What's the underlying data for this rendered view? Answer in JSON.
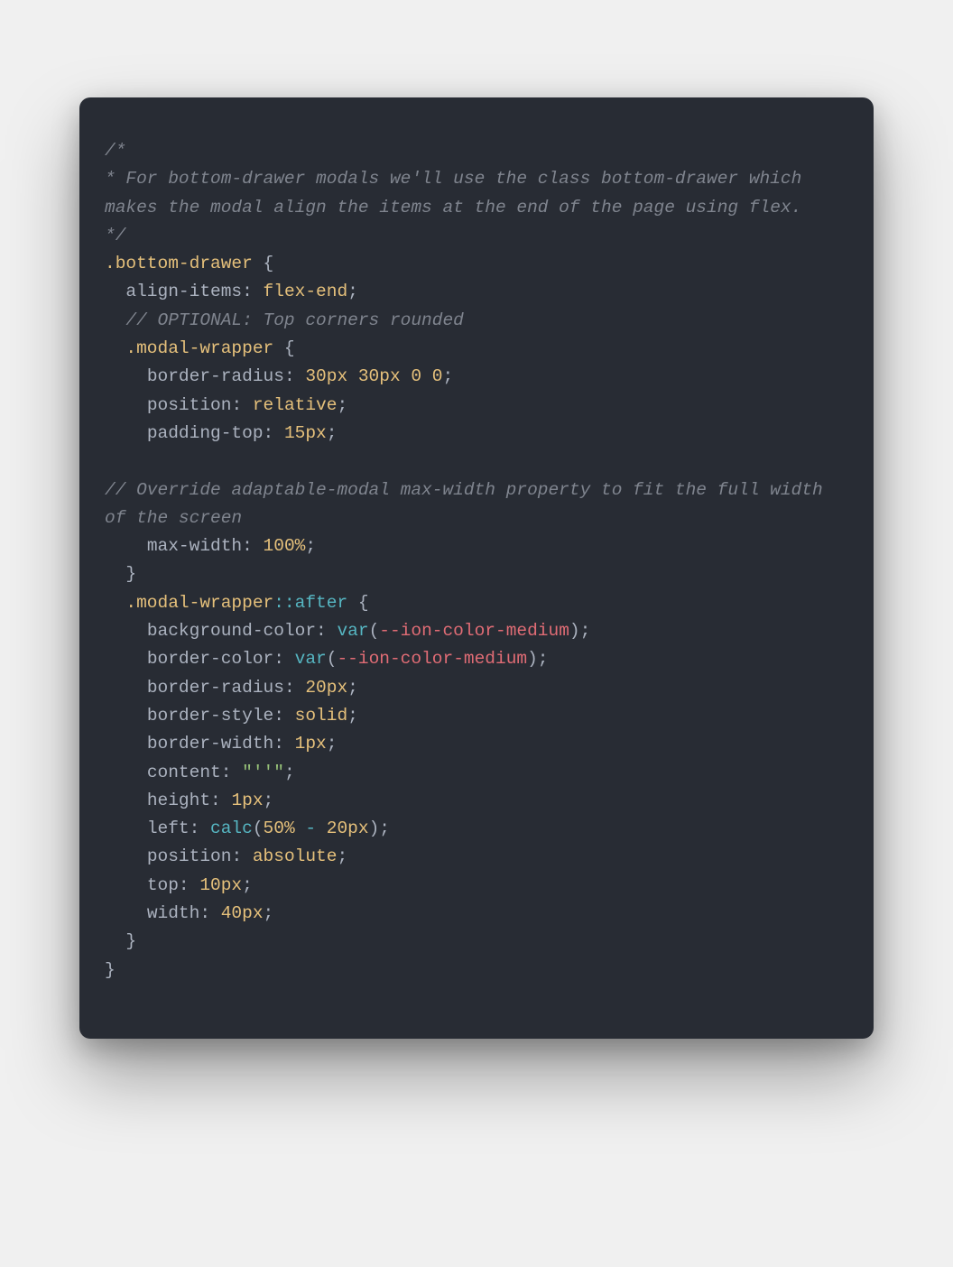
{
  "code": {
    "language": "scss",
    "tokens": [
      {
        "c": "tok-comment",
        "t": "/*"
      },
      {
        "nl": 1
      },
      {
        "c": "tok-comment",
        "t": "* For bottom-drawer modals we'll use the class bottom-drawer which makes the modal align the items at the end of the page using flex."
      },
      {
        "nl": 1
      },
      {
        "c": "tok-comment",
        "t": "*/"
      },
      {
        "nl": 1
      },
      {
        "c": "tok-selector",
        "t": ".bottom-drawer"
      },
      {
        "c": "tok-punct",
        "t": " {"
      },
      {
        "nl": 1
      },
      {
        "t": "  "
      },
      {
        "c": "tok-prop",
        "t": "align-items"
      },
      {
        "c": "tok-punct",
        "t": ": "
      },
      {
        "c": "tok-value",
        "t": "flex-end"
      },
      {
        "c": "tok-punct",
        "t": ";"
      },
      {
        "nl": 1
      },
      {
        "t": "  "
      },
      {
        "c": "tok-comment",
        "t": "// OPTIONAL: Top corners rounded"
      },
      {
        "nl": 1
      },
      {
        "t": "  "
      },
      {
        "c": "tok-selector",
        "t": ".modal-wrapper"
      },
      {
        "c": "tok-punct",
        "t": " {"
      },
      {
        "nl": 1
      },
      {
        "t": "    "
      },
      {
        "c": "tok-prop",
        "t": "border-radius"
      },
      {
        "c": "tok-punct",
        "t": ": "
      },
      {
        "c": "tok-number",
        "t": "30px 30px 0 0"
      },
      {
        "c": "tok-punct",
        "t": ";"
      },
      {
        "nl": 1
      },
      {
        "t": "    "
      },
      {
        "c": "tok-prop",
        "t": "position"
      },
      {
        "c": "tok-punct",
        "t": ": "
      },
      {
        "c": "tok-value",
        "t": "relative"
      },
      {
        "c": "tok-punct",
        "t": ";"
      },
      {
        "nl": 1
      },
      {
        "t": "    "
      },
      {
        "c": "tok-prop",
        "t": "padding-top"
      },
      {
        "c": "tok-punct",
        "t": ": "
      },
      {
        "c": "tok-number",
        "t": "15px"
      },
      {
        "c": "tok-punct",
        "t": ";"
      },
      {
        "nl": 1
      },
      {
        "nl": 1
      },
      {
        "c": "tok-comment",
        "t": "// Override adaptable-modal max-width property to fit the full width of the screen"
      },
      {
        "nl": 1
      },
      {
        "t": "    "
      },
      {
        "c": "tok-prop",
        "t": "max-width"
      },
      {
        "c": "tok-punct",
        "t": ": "
      },
      {
        "c": "tok-number",
        "t": "100%"
      },
      {
        "c": "tok-punct",
        "t": ";"
      },
      {
        "nl": 1
      },
      {
        "t": "  "
      },
      {
        "c": "tok-punct",
        "t": "}"
      },
      {
        "nl": 1
      },
      {
        "t": "  "
      },
      {
        "c": "tok-selector",
        "t": ".modal-wrapper"
      },
      {
        "c": "tok-pseudo",
        "t": "::after"
      },
      {
        "c": "tok-punct",
        "t": " {"
      },
      {
        "nl": 1
      },
      {
        "t": "    "
      },
      {
        "c": "tok-prop",
        "t": "background-color"
      },
      {
        "c": "tok-punct",
        "t": ": "
      },
      {
        "c": "tok-func",
        "t": "var"
      },
      {
        "c": "tok-punct",
        "t": "("
      },
      {
        "c": "tok-varname",
        "t": "--ion-color-medium"
      },
      {
        "c": "tok-punct",
        "t": ");"
      },
      {
        "nl": 1
      },
      {
        "t": "    "
      },
      {
        "c": "tok-prop",
        "t": "border-color"
      },
      {
        "c": "tok-punct",
        "t": ": "
      },
      {
        "c": "tok-func",
        "t": "var"
      },
      {
        "c": "tok-punct",
        "t": "("
      },
      {
        "c": "tok-varname",
        "t": "--ion-color-medium"
      },
      {
        "c": "tok-punct",
        "t": ");"
      },
      {
        "nl": 1
      },
      {
        "t": "    "
      },
      {
        "c": "tok-prop",
        "t": "border-radius"
      },
      {
        "c": "tok-punct",
        "t": ": "
      },
      {
        "c": "tok-number",
        "t": "20px"
      },
      {
        "c": "tok-punct",
        "t": ";"
      },
      {
        "nl": 1
      },
      {
        "t": "    "
      },
      {
        "c": "tok-prop",
        "t": "border-style"
      },
      {
        "c": "tok-punct",
        "t": ": "
      },
      {
        "c": "tok-value",
        "t": "solid"
      },
      {
        "c": "tok-punct",
        "t": ";"
      },
      {
        "nl": 1
      },
      {
        "t": "    "
      },
      {
        "c": "tok-prop",
        "t": "border-width"
      },
      {
        "c": "tok-punct",
        "t": ": "
      },
      {
        "c": "tok-number",
        "t": "1px"
      },
      {
        "c": "tok-punct",
        "t": ";"
      },
      {
        "nl": 1
      },
      {
        "t": "    "
      },
      {
        "c": "tok-prop",
        "t": "content"
      },
      {
        "c": "tok-punct",
        "t": ": "
      },
      {
        "c": "tok-string",
        "t": "\"''\""
      },
      {
        "c": "tok-punct",
        "t": ";"
      },
      {
        "nl": 1
      },
      {
        "t": "    "
      },
      {
        "c": "tok-prop",
        "t": "height"
      },
      {
        "c": "tok-punct",
        "t": ": "
      },
      {
        "c": "tok-number",
        "t": "1px"
      },
      {
        "c": "tok-punct",
        "t": ";"
      },
      {
        "nl": 1
      },
      {
        "t": "    "
      },
      {
        "c": "tok-prop",
        "t": "left"
      },
      {
        "c": "tok-punct",
        "t": ": "
      },
      {
        "c": "tok-func",
        "t": "calc"
      },
      {
        "c": "tok-punct",
        "t": "("
      },
      {
        "c": "tok-number",
        "t": "50%"
      },
      {
        "c": "tok-operator",
        "t": " - "
      },
      {
        "c": "tok-number",
        "t": "20px"
      },
      {
        "c": "tok-punct",
        "t": ");"
      },
      {
        "nl": 1
      },
      {
        "t": "    "
      },
      {
        "c": "tok-prop",
        "t": "position"
      },
      {
        "c": "tok-punct",
        "t": ": "
      },
      {
        "c": "tok-value",
        "t": "absolute"
      },
      {
        "c": "tok-punct",
        "t": ";"
      },
      {
        "nl": 1
      },
      {
        "t": "    "
      },
      {
        "c": "tok-prop",
        "t": "top"
      },
      {
        "c": "tok-punct",
        "t": ": "
      },
      {
        "c": "tok-number",
        "t": "10px"
      },
      {
        "c": "tok-punct",
        "t": ";"
      },
      {
        "nl": 1
      },
      {
        "t": "    "
      },
      {
        "c": "tok-prop",
        "t": "width"
      },
      {
        "c": "tok-punct",
        "t": ": "
      },
      {
        "c": "tok-number",
        "t": "40px"
      },
      {
        "c": "tok-punct",
        "t": ";"
      },
      {
        "nl": 1
      },
      {
        "t": "  "
      },
      {
        "c": "tok-punct",
        "t": "}"
      },
      {
        "nl": 1
      },
      {
        "c": "tok-punct",
        "t": "}"
      }
    ]
  }
}
